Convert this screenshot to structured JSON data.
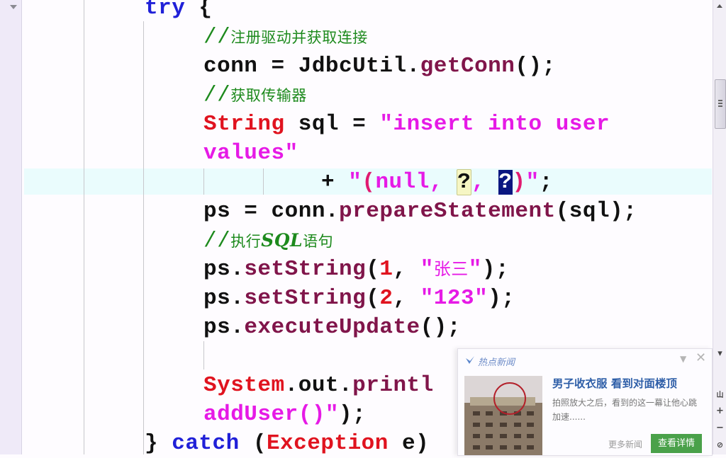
{
  "editor": {
    "lines": [
      {
        "tokens": [
          {
            "t": "try",
            "c": "kw"
          },
          {
            "t": " {",
            "c": "pl"
          }
        ]
      },
      {
        "tokens": [
          {
            "t": "//",
            "c": "cmt"
          },
          {
            "t": "注册驱动并获取连接",
            "c": "cmt-zh"
          }
        ]
      },
      {
        "tokens": [
          {
            "t": "conn = JdbcUtil.",
            "c": "pl"
          },
          {
            "t": "getConn",
            "c": "mth"
          },
          {
            "t": "();",
            "c": "pl"
          }
        ]
      },
      {
        "tokens": [
          {
            "t": "//",
            "c": "cmt"
          },
          {
            "t": "获取传输器",
            "c": "cmt-zh"
          }
        ]
      },
      {
        "tokens": [
          {
            "t": "String",
            "c": "typ"
          },
          {
            "t": " sql = ",
            "c": "pl"
          },
          {
            "t": "\"insert into user",
            "c": "str"
          }
        ]
      },
      {
        "tokens": [
          {
            "t": "values\"",
            "c": "str"
          }
        ]
      },
      {
        "tokens": [
          {
            "t": "+ ",
            "c": "pl"
          },
          {
            "t": "\"",
            "c": "str"
          },
          {
            "t": "(",
            "c": "paren-hl"
          },
          {
            "t": "null, ",
            "c": "str"
          },
          {
            "t": "?",
            "c": "q-occ"
          },
          {
            "t": ", ",
            "c": "str"
          },
          {
            "t": "?",
            "c": "q-sel"
          },
          {
            "t": ")",
            "c": "paren-hl"
          },
          {
            "t": "\"",
            "c": "str"
          },
          {
            "t": ";",
            "c": "pl"
          }
        ]
      },
      {
        "tokens": [
          {
            "t": "ps = conn.",
            "c": "pl"
          },
          {
            "t": "prepareStatement",
            "c": "mth"
          },
          {
            "t": "(sql);",
            "c": "pl"
          }
        ]
      },
      {
        "tokens": [
          {
            "t": "//",
            "c": "cmt"
          },
          {
            "t": "执行",
            "c": "cmt-zh"
          },
          {
            "t": "SQL",
            "c": "cmt-sql"
          },
          {
            "t": "语句",
            "c": "cmt-zh"
          }
        ]
      },
      {
        "tokens": [
          {
            "t": "ps.",
            "c": "pl"
          },
          {
            "t": "setString",
            "c": "mth"
          },
          {
            "t": "(",
            "c": "pl"
          },
          {
            "t": "1",
            "c": "num"
          },
          {
            "t": ", ",
            "c": "pl"
          },
          {
            "t": "\"",
            "c": "str"
          },
          {
            "t": "张三",
            "c": "str-zh"
          },
          {
            "t": "\"",
            "c": "str"
          },
          {
            "t": ");",
            "c": "pl"
          }
        ]
      },
      {
        "tokens": [
          {
            "t": "ps.",
            "c": "pl"
          },
          {
            "t": "setString",
            "c": "mth"
          },
          {
            "t": "(",
            "c": "pl"
          },
          {
            "t": "2",
            "c": "num"
          },
          {
            "t": ", ",
            "c": "pl"
          },
          {
            "t": "\"123\"",
            "c": "str"
          },
          {
            "t": ");",
            "c": "pl"
          }
        ]
      },
      {
        "tokens": [
          {
            "t": "ps.",
            "c": "pl"
          },
          {
            "t": "executeUpdate",
            "c": "mth"
          },
          {
            "t": "();",
            "c": "pl"
          }
        ]
      },
      {
        "tokens": []
      },
      {
        "tokens": [
          {
            "t": "System",
            "c": "typ"
          },
          {
            "t": ".out.",
            "c": "pl"
          },
          {
            "t": "printl",
            "c": "mth"
          }
        ]
      },
      {
        "tokens": [
          {
            "t": "addUser()\"",
            "c": "str"
          },
          {
            "t": ");",
            "c": "pl"
          }
        ]
      },
      {
        "tokens": [
          {
            "t": "} ",
            "c": "pl"
          },
          {
            "t": "catch",
            "c": "kw"
          },
          {
            "t": " (",
            "c": "pl"
          },
          {
            "t": "Exception",
            "c": "typ"
          },
          {
            "t": " e)",
            "c": "pl"
          }
        ]
      }
    ]
  },
  "news_popup": {
    "brand": "热点新闻",
    "headline": "男子收衣服 看到对面楼顶",
    "description": "拍照放大之后，看到的这一幕让他心跳加速......",
    "more_label": "更多新闻",
    "detail_label": "查看详情",
    "accent_color": "#4aa14a"
  },
  "scrollbar": {
    "tools": [
      "▾",
      "山",
      "+",
      "−",
      "⊘"
    ]
  }
}
